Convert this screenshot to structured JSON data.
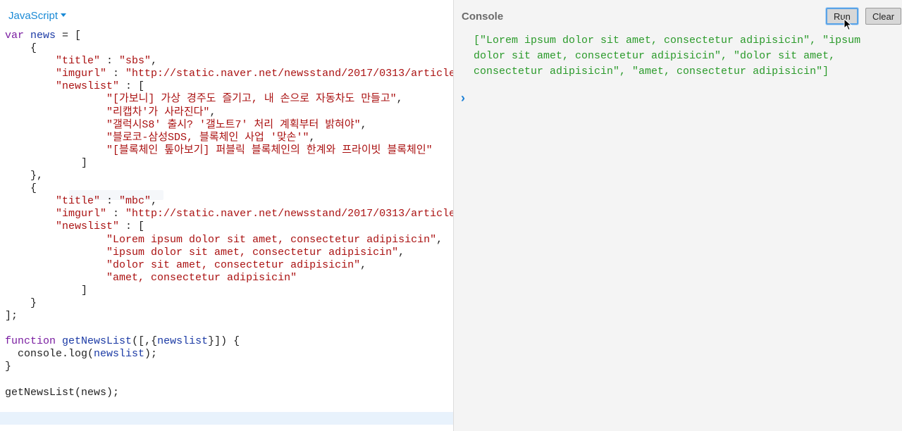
{
  "editor": {
    "language": "JavaScript",
    "code_lines": [
      "var news = [",
      "    {",
      "        \"title\" : \"sbs\",",
      "        \"imgurl\" : \"http://static.naver.net/newsstand/2017/0313/article_img/9054/173200/001.jpg\",",
      "        \"newslist\" : [",
      "                \"[가보니] 가상 경주도 즐기고, 내 손으로 자동차도 만들고\",",
      "                \"리캡차'가 사라진다\",",
      "                \"갤럭시S8' 출시? '갤노트7' 처리 계획부터 밝혀야\",",
      "                \"블로코-삼성SDS, 블록체인 사업 '맞손'\",",
      "                \"[블록체인 톺아보기] 퍼블릭 블록체인의 한계와 프라이빗 블록체인\"",
      "            ]",
      "    },",
      "    {",
      "        \"title\" : \"mbc\",",
      "        \"imgurl\" : \"http://static.naver.net/newsstand/2017/0313/article_img/9005/220733/001.jpg\",",
      "        \"newslist\" : [",
      "                \"Lorem ipsum dolor sit amet, consectetur adipisicin\",",
      "                \"ipsum dolor sit amet, consectetur adipisicin\",",
      "                \"dolor sit amet, consectetur adipisicin\",",
      "                \"amet, consectetur adipisicin\"",
      "            ]",
      "    }",
      "];",
      "",
      "function getNewsList([,{newslist}]) {",
      "  console.log(newslist);",
      "}",
      "",
      "getNewsList(news);",
      "",
      ""
    ]
  },
  "console": {
    "title": "Console",
    "run_label": "Run",
    "clear_label": "Clear",
    "output": "[\"Lorem ipsum dolor sit amet, consectetur adipisicin\", \"ipsum dolor sit amet, consectetur adipisicin\", \"dolor sit amet, consectetur adipisicin\", \"amet, consectetur adipisicin\"]",
    "prompt_symbol": "›"
  }
}
